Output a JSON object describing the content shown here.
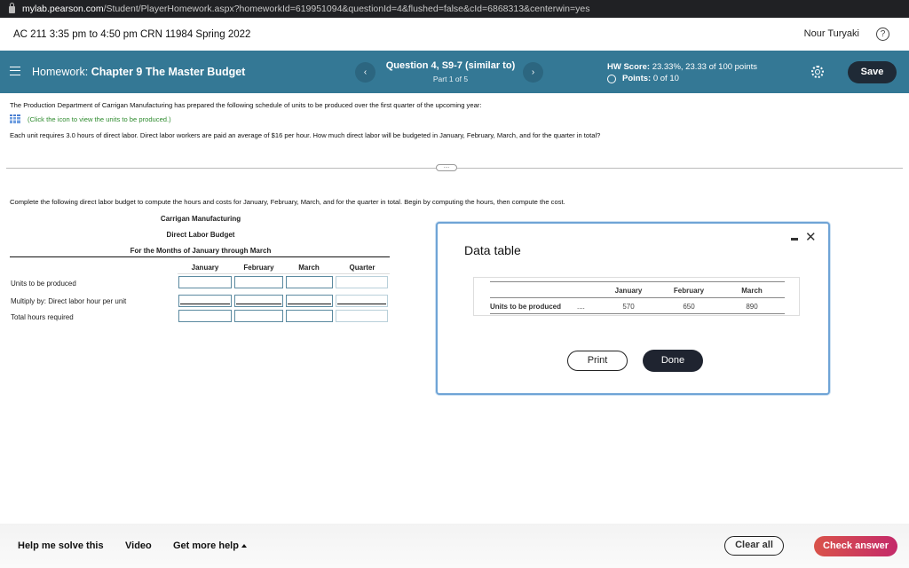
{
  "browser": {
    "url_host": "mylab.pearson.com",
    "url_path": "/Student/PlayerHomework.aspx?homeworkId=619951094&questionId=4&flushed=false&cId=6868313&centerwin=yes"
  },
  "course": {
    "title": "AC 211 3:35 pm to 4:50 pm CRN 11984 Spring 2022",
    "user_name": "Nour Turyaki",
    "help_icon": "?"
  },
  "homework_bar": {
    "prefix": "Homework:",
    "name": "Chapter 9 The Master Budget",
    "prev_glyph": "‹",
    "next_glyph": "›",
    "question_title": "Question 4, S9-7 (similar to)",
    "question_part": "Part 1 of 5",
    "score_label": "HW Score:",
    "score_value": "23.33%, 23.33 of 100 points",
    "points_label": "Points:",
    "points_value": "0 of 10",
    "save_label": "Save",
    "bar_color": "#347895"
  },
  "question": {
    "intro": "The Production Department of Carrigan Manufacturing has prepared the following schedule of units to be produced over the first quarter of the upcoming year:",
    "hint": "(Click the icon to view the units to be produced.)",
    "details": "Each unit requires 3.0 hours of direct labor. Direct labor workers are paid an average of $16 per hour. How much direct labor will be budgeted in January, February, March, and for the quarter in total?",
    "divider_handle": "....",
    "instruction": "Complete the following direct labor budget to compute the hours and costs for January, February, March, and for the quarter in total. Begin by computing the hours, then compute the cost."
  },
  "budget": {
    "company": "Carrigan Manufacturing",
    "title": "Direct Labor Budget",
    "period": "For the Months of January through March",
    "columns": [
      "January",
      "February",
      "March",
      "Quarter"
    ],
    "rows": [
      {
        "label": "Units to be produced",
        "values": [
          "",
          "",
          "",
          ""
        ]
      },
      {
        "label": "Multiply by: Direct labor hour per unit",
        "values": [
          "",
          "",
          "",
          ""
        ]
      },
      {
        "label": "Total hours required",
        "values": [
          "",
          "",
          "",
          ""
        ]
      }
    ]
  },
  "data_table_modal": {
    "title": "Data table",
    "minimize_glyph": "−",
    "close_glyph": "✕",
    "columns": [
      "January",
      "February",
      "March"
    ],
    "row_label": "Units to be produced",
    "row_dots": "....",
    "values": [
      "570",
      "650",
      "890"
    ],
    "print_label": "Print",
    "done_label": "Done"
  },
  "footer": {
    "help_me_solve": "Help me solve this",
    "video": "Video",
    "get_more_help": "Get more help",
    "clear_all": "Clear all",
    "check_answer": "Check answer"
  }
}
